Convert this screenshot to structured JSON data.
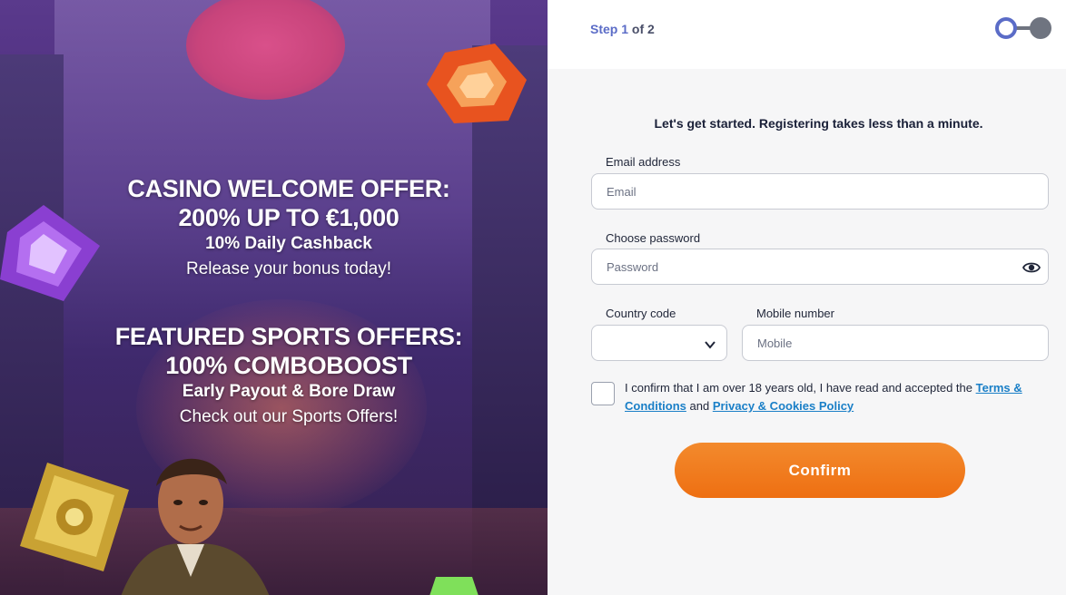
{
  "promo": {
    "casino_title_line1": "CASINO WELCOME OFFER:",
    "casino_title_line2": "200% UP TO €1,000",
    "casino_sub": "10% Daily Cashback",
    "casino_note": "Release your bonus today!",
    "sports_title_line1": "FEATURED SPORTS OFFERS:",
    "sports_title_line2": "100% COMBOBOOST",
    "sports_sub": "Early Payout & Bore Draw",
    "sports_note": "Check out our Sports Offers!"
  },
  "header": {
    "step_prefix": "Step 1",
    "step_suffix": "of 2",
    "progress": {
      "current_step": 1,
      "total_steps": 2
    }
  },
  "form": {
    "intro": "Let's get started. Registering takes less than a minute.",
    "email_label": "Email address",
    "email_placeholder": "Email",
    "email_value": "",
    "password_label": "Choose password",
    "password_placeholder": "Password",
    "password_value": "",
    "country_code_label": "Country code",
    "country_code_value": "",
    "mobile_label": "Mobile number",
    "mobile_placeholder": "Mobile",
    "mobile_value": "",
    "consent_text_start": "I confirm that I am over 18 years old, I have read and accepted the ",
    "terms_link": "Terms & Conditions",
    "consent_text_mid": " and ",
    "privacy_link": "Privacy & Cookies Policy",
    "confirm_label": "Confirm"
  },
  "colors": {
    "accent_orange": "#ee6f12",
    "step_blue": "#5b6cc7",
    "link_blue": "#1a7fc7"
  },
  "icons": [
    "eye-icon",
    "chevron-down-icon",
    "progress-dot-active-icon",
    "progress-dot-inactive-icon"
  ]
}
